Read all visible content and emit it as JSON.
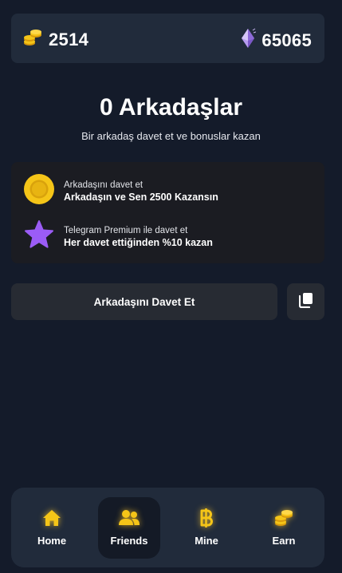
{
  "balances": {
    "coins": "2514",
    "coins_icon": "coin-stack-icon",
    "gems": "65065",
    "gems_icon": "gem-icon"
  },
  "header": {
    "title": "0 Arkadaşlar",
    "subtitle": "Bir arkadaş davet et ve bonuslar kazan"
  },
  "bonuses": [
    {
      "icon": "gold-coin-icon",
      "label": "Arkadaşını davet et",
      "reward": "Arkadaşın ve Sen 2500 Kazansın"
    },
    {
      "icon": "star-icon",
      "label": "Telegram Premium ile davet et",
      "reward": "Her davet ettiğinden %10 kazan"
    }
  ],
  "invite": {
    "button_label": "Arkadaşını Davet Et",
    "copy_icon": "copy-icon"
  },
  "nav": {
    "active": "Friends",
    "items": [
      {
        "label": "Home",
        "icon": "home-icon"
      },
      {
        "label": "Friends",
        "icon": "friends-icon"
      },
      {
        "label": "Mine",
        "icon": "baht-icon"
      },
      {
        "label": "Earn",
        "icon": "coin-stack-icon"
      }
    ]
  },
  "colors": {
    "background": "#141b2a",
    "panel": "#212b3b",
    "card": "#1b1c22",
    "button": "#272b33",
    "accent_gold": "#f5c518",
    "accent_purple": "#9b5cf6"
  }
}
